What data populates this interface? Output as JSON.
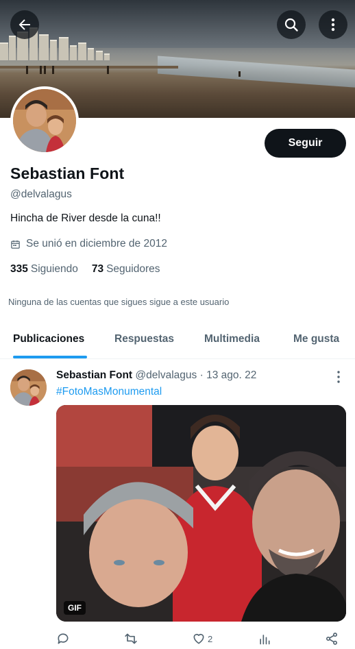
{
  "header": {
    "back_icon": "arrow-left-icon",
    "search_icon": "search-icon",
    "more_icon": "more-vertical-icon"
  },
  "profile": {
    "name": "Sebastian Font",
    "handle": "@delvalagus",
    "bio": "Hincha de River desde la cuna!!",
    "joined": "Se unió en diciembre de 2012",
    "following_count": "335",
    "following_label": "Siguiendo",
    "followers_count": "73",
    "followers_label": "Seguidores",
    "not_followed_note": "Ninguna de las cuentas que sigues sigue a este usuario",
    "follow_button": "Seguir"
  },
  "tabs": [
    {
      "label": "Publicaciones",
      "active": true
    },
    {
      "label": "Respuestas",
      "active": false
    },
    {
      "label": "Multimedia",
      "active": false
    },
    {
      "label": "Me gusta",
      "active": false
    }
  ],
  "post": {
    "author_name": "Sebastian Font",
    "author_handle": "@delvalagus",
    "separator": "·",
    "date": "13 ago. 22",
    "text": "#FotoMasMonumental",
    "media_badge": "GIF",
    "actions": {
      "reply_count": "",
      "retweet_count": "",
      "like_count": "2",
      "views_count": "",
      "share_icon": "share-icon"
    }
  },
  "colors": {
    "accent": "#1d9bf0",
    "text_primary": "#0f1419",
    "text_secondary": "#536471",
    "follow_button_bg": "#0f1419"
  }
}
